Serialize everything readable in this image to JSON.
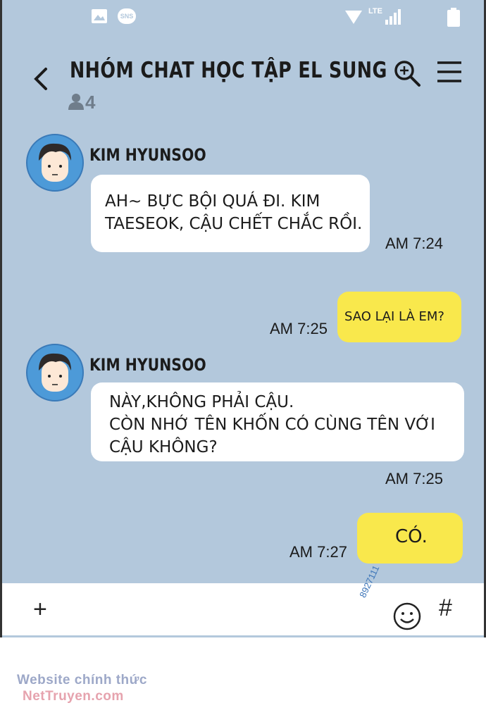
{
  "status_bar": {
    "sns_label": "SNS",
    "lte_label": "LTE"
  },
  "header": {
    "title": "NHÓM CHAT HỌC TẬP EL SUNG",
    "member_count": "4"
  },
  "messages": [
    {
      "sender": "KIM HYUNSOO",
      "text": "AH~ BỰC BỘI QUÁ ĐI. KIM\nTAESEOK, CẬU CHẾT CHẮC RỒI.",
      "time": "AM 7:24"
    },
    {
      "text": "SAO LẠI LÀ EM?",
      "time": "AM 7:25"
    },
    {
      "sender": "KIM HYUNSOO",
      "text": "NÀY,KHÔNG PHẢI CẬU.\nCÒN NHỚ TÊN KHỐN CÓ CÙNG TÊN VỚI\nCẬU KHÔNG?",
      "time": "AM 7:25"
    },
    {
      "text": "CÓ.",
      "time": "AM 7:27"
    }
  ],
  "input_bar": {
    "plus": "+",
    "hash": "#"
  },
  "watermark": "8927111",
  "footer": {
    "line1": "Website chính thức",
    "line2": "NetTruyen.com"
  },
  "colors": {
    "chat_bg": "#b3c8dc",
    "my_bubble": "#f9e84c",
    "other_bubble": "#ffffff"
  }
}
